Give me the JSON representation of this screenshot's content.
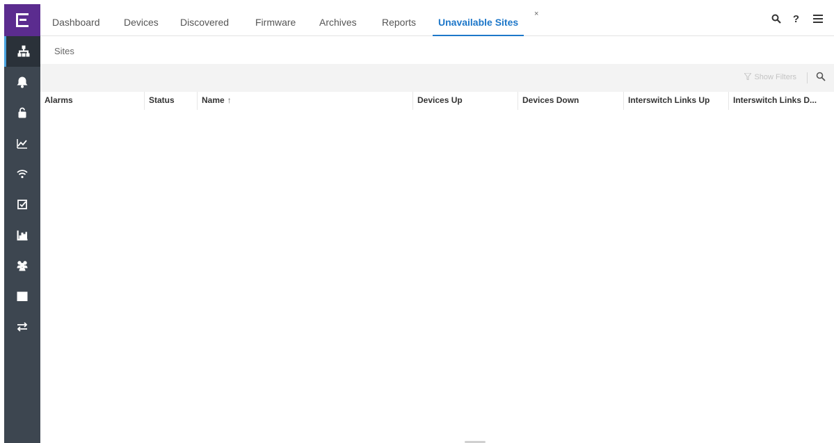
{
  "sidebar": {
    "logo": "logo-icon",
    "items": [
      {
        "icon": "network-icon",
        "active": true
      },
      {
        "icon": "bell-icon"
      },
      {
        "icon": "lock-icon"
      },
      {
        "icon": "line-chart-icon"
      },
      {
        "icon": "wifi-icon"
      },
      {
        "icon": "checkbox-icon"
      },
      {
        "icon": "bar-chart-icon"
      },
      {
        "icon": "users-icon"
      },
      {
        "icon": "server-icon"
      },
      {
        "icon": "transfer-icon"
      }
    ]
  },
  "tabs": [
    {
      "label": "Dashboard"
    },
    {
      "label": "Devices"
    },
    {
      "label": "Discovered"
    },
    {
      "label": "Firmware"
    },
    {
      "label": "Archives"
    },
    {
      "label": "Reports"
    },
    {
      "label": "Unavailable Sites",
      "active": true
    }
  ],
  "tab_close": "×",
  "top_icons": {
    "search": "search-icon",
    "help": "?",
    "menu": "menu-icon"
  },
  "breadcrumb": "Sites",
  "toolbar": {
    "show_filters": "Show Filters"
  },
  "grid": {
    "columns": [
      "Alarms",
      "Status",
      "Name",
      "Devices Up",
      "Devices Down",
      "Interswitch Links Up",
      "Interswitch Links D..."
    ],
    "sort_indicator": "↑",
    "rows": []
  },
  "colors": {
    "accent": "#1d77c9",
    "sidebar": "#3d4650",
    "logo": "#5b2c8f"
  }
}
